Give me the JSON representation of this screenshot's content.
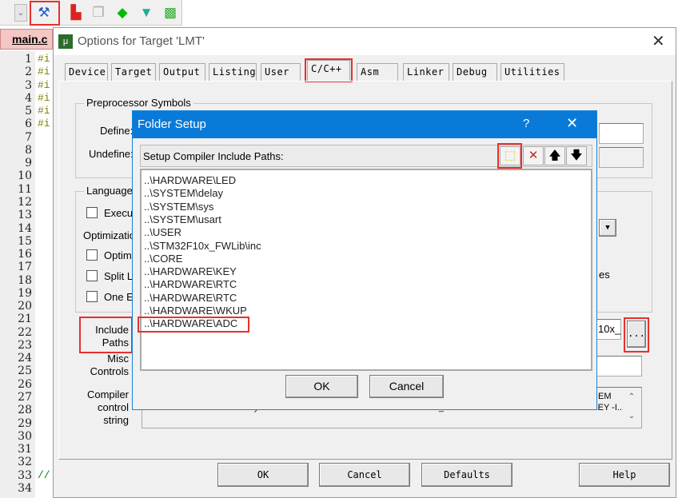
{
  "toolbar": {
    "icons": [
      "dropdown-icon",
      "wizard-icon",
      "component-icon",
      "stack-icon",
      "diamond-icon",
      "funnel-icon",
      "pack-icon"
    ]
  },
  "editor": {
    "tab_label": "main.c",
    "line_numbers": [
      "1",
      "2",
      "3",
      "4",
      "5",
      "6",
      "7",
      "8",
      "9",
      "10",
      "11",
      "12",
      "13",
      "14",
      "15",
      "16",
      "17",
      "18",
      "19",
      "20",
      "21",
      "22",
      "23",
      "24",
      "25",
      "26",
      "27",
      "28",
      "29",
      "30",
      "31",
      "32",
      "33",
      "34"
    ],
    "code_fragments": [
      "#i",
      "#i",
      "#i",
      "#i",
      "#i",
      "#i"
    ],
    "comment_fragment": "//"
  },
  "options": {
    "title": "Options for Target 'LMT'",
    "tabs": [
      "Device",
      "Target",
      "Output",
      "Listing",
      "User",
      "C/C++",
      "Asm",
      "Linker",
      "Debug",
      "Utilities"
    ],
    "active_tab": "C/C++",
    "preprocessor_label": "Preprocessor Symbols",
    "define_label": "Define:",
    "undefine_label": "Undefine:",
    "language_label": "Language",
    "execute_label": "Execu",
    "optimization_label": "Optimizatio",
    "optimize_label": "Optimi",
    "split_label": "Split L",
    "one_label": "One E",
    "right_fragment": "es",
    "include_label_1": "Include",
    "include_label_2": "Paths",
    "include_value": "10x_",
    "browse_label": "...",
    "misc_label_1": "Misc",
    "misc_label_2": "Controls",
    "compiler_label_1": "Compiler",
    "compiler_label_2": "control",
    "compiler_label_3": "string",
    "compiler_line_1": "EM",
    "compiler_line_2": "sys -I..\\SYSTEM\\usart -I..\\USER -I..\\STM32F10x_FWLib\\inc -I..\\CORE -I..\\HARDWARE\\KEY -I..",
    "ok": "OK",
    "cancel": "Cancel",
    "defaults": "Defaults",
    "help": "Help"
  },
  "folder_setup": {
    "title": "Folder Setup",
    "help": "?",
    "header": "Setup Compiler Include Paths:",
    "paths": [
      "..\\HARDWARE\\LED",
      "..\\SYSTEM\\delay",
      "..\\SYSTEM\\sys",
      "..\\SYSTEM\\usart",
      "..\\USER",
      "..\\STM32F10x_FWLib\\inc",
      "..\\CORE",
      "..\\HARDWARE\\KEY",
      "..\\HARDWARE\\RTC",
      "..\\HARDWARE\\RTC",
      "..\\HARDWARE\\WKUP",
      "..\\HARDWARE\\ADC"
    ],
    "highlighted": "..\\HARDWARE\\ADC",
    "ok": "OK",
    "cancel": "Cancel"
  },
  "colors": {
    "highlight": "#e8302c",
    "titlebar": "#0a7ad8"
  }
}
